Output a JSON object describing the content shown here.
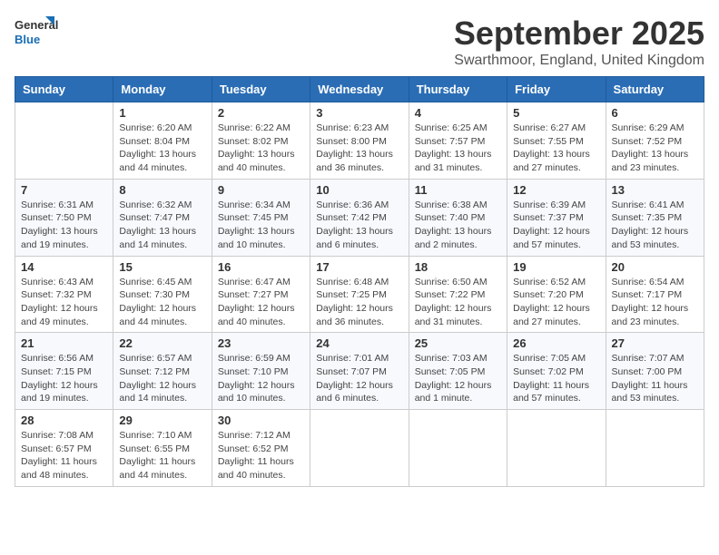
{
  "header": {
    "logo_line1": "General",
    "logo_line2": "Blue",
    "month": "September 2025",
    "location": "Swarthmoor, England, United Kingdom"
  },
  "weekdays": [
    "Sunday",
    "Monday",
    "Tuesday",
    "Wednesday",
    "Thursday",
    "Friday",
    "Saturday"
  ],
  "weeks": [
    [
      {
        "day": "",
        "info": ""
      },
      {
        "day": "1",
        "info": "Sunrise: 6:20 AM\nSunset: 8:04 PM\nDaylight: 13 hours\nand 44 minutes."
      },
      {
        "day": "2",
        "info": "Sunrise: 6:22 AM\nSunset: 8:02 PM\nDaylight: 13 hours\nand 40 minutes."
      },
      {
        "day": "3",
        "info": "Sunrise: 6:23 AM\nSunset: 8:00 PM\nDaylight: 13 hours\nand 36 minutes."
      },
      {
        "day": "4",
        "info": "Sunrise: 6:25 AM\nSunset: 7:57 PM\nDaylight: 13 hours\nand 31 minutes."
      },
      {
        "day": "5",
        "info": "Sunrise: 6:27 AM\nSunset: 7:55 PM\nDaylight: 13 hours\nand 27 minutes."
      },
      {
        "day": "6",
        "info": "Sunrise: 6:29 AM\nSunset: 7:52 PM\nDaylight: 13 hours\nand 23 minutes."
      }
    ],
    [
      {
        "day": "7",
        "info": "Sunrise: 6:31 AM\nSunset: 7:50 PM\nDaylight: 13 hours\nand 19 minutes."
      },
      {
        "day": "8",
        "info": "Sunrise: 6:32 AM\nSunset: 7:47 PM\nDaylight: 13 hours\nand 14 minutes."
      },
      {
        "day": "9",
        "info": "Sunrise: 6:34 AM\nSunset: 7:45 PM\nDaylight: 13 hours\nand 10 minutes."
      },
      {
        "day": "10",
        "info": "Sunrise: 6:36 AM\nSunset: 7:42 PM\nDaylight: 13 hours\nand 6 minutes."
      },
      {
        "day": "11",
        "info": "Sunrise: 6:38 AM\nSunset: 7:40 PM\nDaylight: 13 hours\nand 2 minutes."
      },
      {
        "day": "12",
        "info": "Sunrise: 6:39 AM\nSunset: 7:37 PM\nDaylight: 12 hours\nand 57 minutes."
      },
      {
        "day": "13",
        "info": "Sunrise: 6:41 AM\nSunset: 7:35 PM\nDaylight: 12 hours\nand 53 minutes."
      }
    ],
    [
      {
        "day": "14",
        "info": "Sunrise: 6:43 AM\nSunset: 7:32 PM\nDaylight: 12 hours\nand 49 minutes."
      },
      {
        "day": "15",
        "info": "Sunrise: 6:45 AM\nSunset: 7:30 PM\nDaylight: 12 hours\nand 44 minutes."
      },
      {
        "day": "16",
        "info": "Sunrise: 6:47 AM\nSunset: 7:27 PM\nDaylight: 12 hours\nand 40 minutes."
      },
      {
        "day": "17",
        "info": "Sunrise: 6:48 AM\nSunset: 7:25 PM\nDaylight: 12 hours\nand 36 minutes."
      },
      {
        "day": "18",
        "info": "Sunrise: 6:50 AM\nSunset: 7:22 PM\nDaylight: 12 hours\nand 31 minutes."
      },
      {
        "day": "19",
        "info": "Sunrise: 6:52 AM\nSunset: 7:20 PM\nDaylight: 12 hours\nand 27 minutes."
      },
      {
        "day": "20",
        "info": "Sunrise: 6:54 AM\nSunset: 7:17 PM\nDaylight: 12 hours\nand 23 minutes."
      }
    ],
    [
      {
        "day": "21",
        "info": "Sunrise: 6:56 AM\nSunset: 7:15 PM\nDaylight: 12 hours\nand 19 minutes."
      },
      {
        "day": "22",
        "info": "Sunrise: 6:57 AM\nSunset: 7:12 PM\nDaylight: 12 hours\nand 14 minutes."
      },
      {
        "day": "23",
        "info": "Sunrise: 6:59 AM\nSunset: 7:10 PM\nDaylight: 12 hours\nand 10 minutes."
      },
      {
        "day": "24",
        "info": "Sunrise: 7:01 AM\nSunset: 7:07 PM\nDaylight: 12 hours\nand 6 minutes."
      },
      {
        "day": "25",
        "info": "Sunrise: 7:03 AM\nSunset: 7:05 PM\nDaylight: 12 hours\nand 1 minute."
      },
      {
        "day": "26",
        "info": "Sunrise: 7:05 AM\nSunset: 7:02 PM\nDaylight: 11 hours\nand 57 minutes."
      },
      {
        "day": "27",
        "info": "Sunrise: 7:07 AM\nSunset: 7:00 PM\nDaylight: 11 hours\nand 53 minutes."
      }
    ],
    [
      {
        "day": "28",
        "info": "Sunrise: 7:08 AM\nSunset: 6:57 PM\nDaylight: 11 hours\nand 48 minutes."
      },
      {
        "day": "29",
        "info": "Sunrise: 7:10 AM\nSunset: 6:55 PM\nDaylight: 11 hours\nand 44 minutes."
      },
      {
        "day": "30",
        "info": "Sunrise: 7:12 AM\nSunset: 6:52 PM\nDaylight: 11 hours\nand 40 minutes."
      },
      {
        "day": "",
        "info": ""
      },
      {
        "day": "",
        "info": ""
      },
      {
        "day": "",
        "info": ""
      },
      {
        "day": "",
        "info": ""
      }
    ]
  ]
}
